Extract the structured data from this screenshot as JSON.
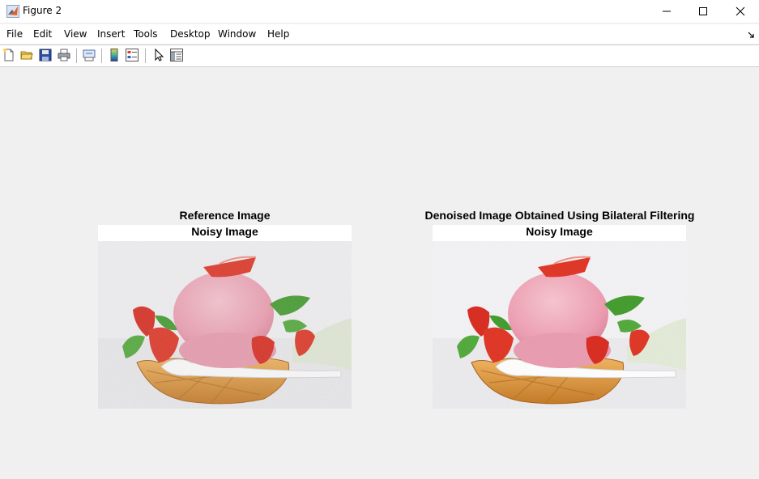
{
  "window": {
    "title": "Figure 2"
  },
  "menu": [
    "File",
    "Edit",
    "View",
    "Insert",
    "Tools",
    "Desktop",
    "Window",
    "Help"
  ],
  "toolbar_icons": [
    "new-figure-icon",
    "open-file-icon",
    "save-icon",
    "print-icon",
    "link-plot-icon",
    "colorbar-icon",
    "legend-icon",
    "edit-plot-icon",
    "property-inspector-icon"
  ],
  "axes": [
    {
      "title_line1": "Reference Image",
      "title_line2": "Noisy Image",
      "noisy": true
    },
    {
      "title_line1": "Denoised Image Obtained Using Bilateral Filtering",
      "title_line2": "Noisy Image",
      "noisy": false
    }
  ],
  "colors": {
    "figure_bg": "#f0f0f0",
    "icecream": "#f0a3b3",
    "cone": "#d8882f",
    "strawberry": "#e0301f",
    "mint": "#3e9a28"
  }
}
